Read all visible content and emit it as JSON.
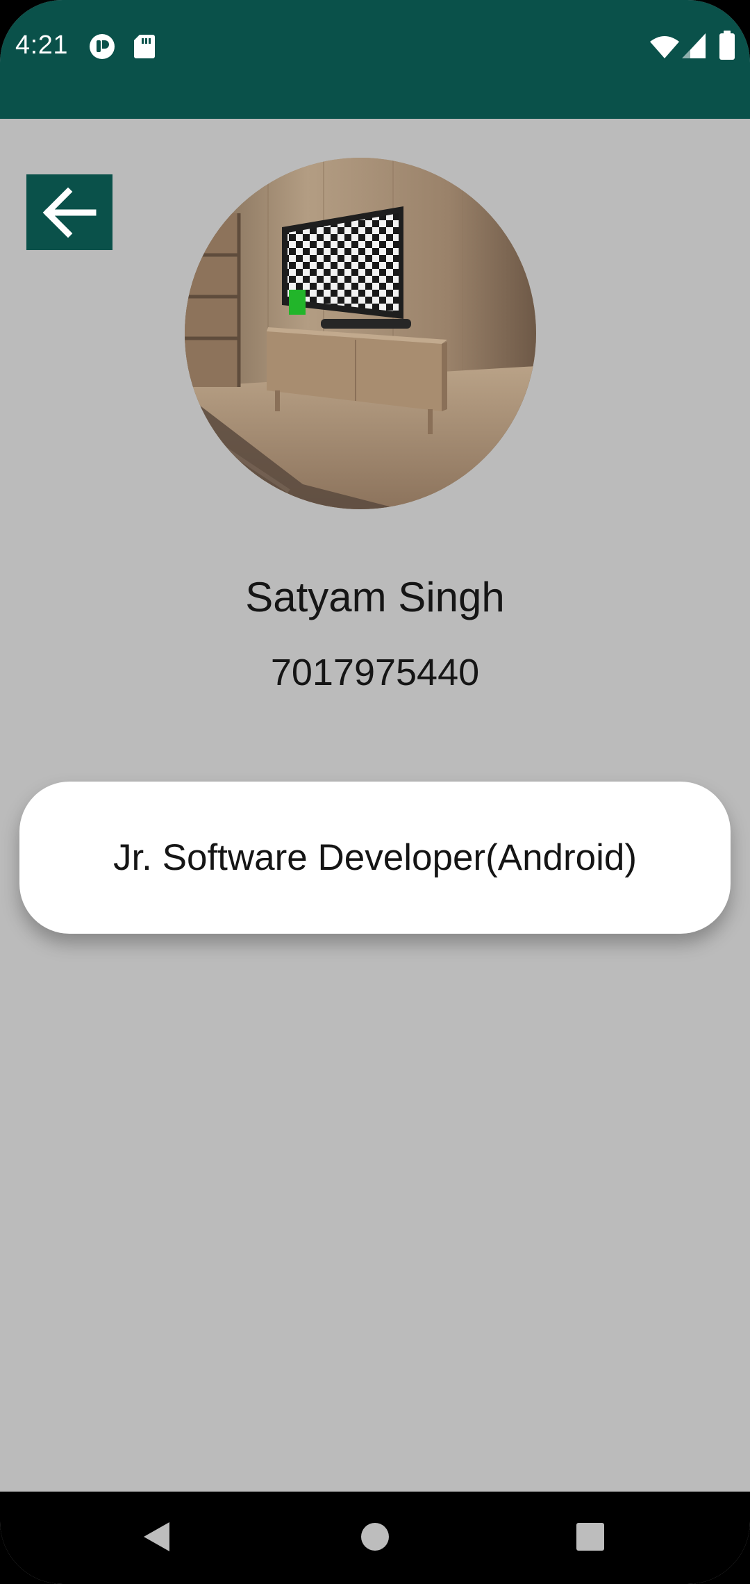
{
  "status_bar": {
    "time": "4:21",
    "icons": [
      "assistant-icon",
      "sd-card-icon",
      "wifi-icon",
      "cellular-signal-icon",
      "battery-icon"
    ]
  },
  "toolbar": {
    "back_icon": "arrow-left-icon"
  },
  "profile": {
    "avatar_icon": "profile-photo",
    "name": "Satyam Singh",
    "phone": "7017975440",
    "designation": "Jr. Software Developer(Android)"
  },
  "navigation_bar": {
    "buttons": [
      "back-triangle-icon",
      "home-circle-icon",
      "recents-square-icon"
    ]
  },
  "colors": {
    "primary": "#0a514a",
    "background": "#bbbbbb",
    "card": "#ffffff",
    "text": "#151515"
  }
}
